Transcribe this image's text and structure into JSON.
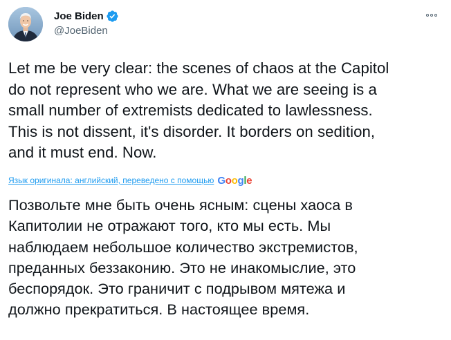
{
  "author": {
    "display_name": "Joe Biden",
    "handle": "@JoeBiden",
    "verified": true,
    "avatar_icon": "avatar-photo"
  },
  "menu_icon": "more-options-icon",
  "tweet": {
    "lines": [
      "Let me be very clear: the scenes of chaos at the Capitol",
      "do not represent who we are. What we are seeing is a",
      "small number of extremists dedicated to lawlessness.",
      "This is not dissent, it's disorder. It borders on sedition,",
      "and it must end. Now."
    ]
  },
  "translation": {
    "link_text": "Язык оригинала: английский, переведено с помощью",
    "provider_letters": [
      "G",
      "o",
      "o",
      "g",
      "l",
      "e"
    ],
    "lines": [
      "Позвольте мне быть очень ясным: сцены хаоса в",
      "Капитолии не отражают того, кто мы есть. Мы",
      "наблюдаем небольшое количество экстремистов,",
      "преданных беззаконию. Это не инакомыслие, это",
      "беспорядок. Это граничит с подрывом мятежа и",
      "должно прекратиться. В настоящее время."
    ]
  },
  "colors": {
    "verified_badge": "#1d9bf0",
    "link": "#1d9bf0",
    "secondary_text": "#536471",
    "primary_text": "#0f1419"
  }
}
